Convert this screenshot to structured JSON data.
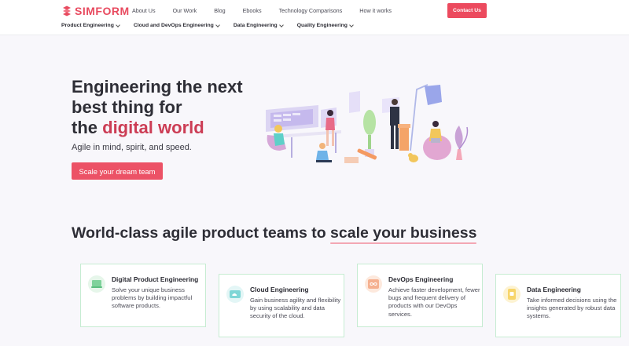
{
  "brand": {
    "name": "SIMFORM"
  },
  "topnav": [
    "About Us",
    "Our Work",
    "Blog",
    "Ebooks",
    "Technology Comparisons",
    "How it works"
  ],
  "contact_label": "Contact Us",
  "subnav": [
    "Product Engineering",
    "Cloud and DevOps Engineering",
    "Data Engineering",
    "Quality Engineering"
  ],
  "hero": {
    "line1": "Engineering the next",
    "line2": "best thing for",
    "line3a": "the ",
    "line3b": "digital world",
    "subtitle": "Agile in mind, spirit, and speed.",
    "cta": "Scale your dream team"
  },
  "section": {
    "title_a": "World-class agile product teams to ",
    "title_b": "scale your business"
  },
  "cards": [
    {
      "title": "Digital Product Engineering",
      "desc": "Solve your unique business problems by building impactful software products.",
      "icon": "laptop-icon",
      "color": "#7fd29b"
    },
    {
      "title": "Cloud Engineering",
      "desc": "Gain business agility and flexibility by using scalability and data security of the cloud.",
      "icon": "cloud-icon",
      "color": "#7fd6d6"
    },
    {
      "title": "DevOps Engineering",
      "desc": "Achieve faster development, fewer bugs and frequent delivery of products with our DevOps services.",
      "icon": "infinity-icon",
      "color": "#f5b08f"
    },
    {
      "title": "Data Engineering",
      "desc": "Take informed decisions using the insights generated by robust data systems.",
      "icon": "database-icon",
      "color": "#f7d56a"
    }
  ],
  "colors": {
    "brand": "#e84a5f",
    "accent": "#cc3d55",
    "card_border": "#c6ecd2"
  }
}
